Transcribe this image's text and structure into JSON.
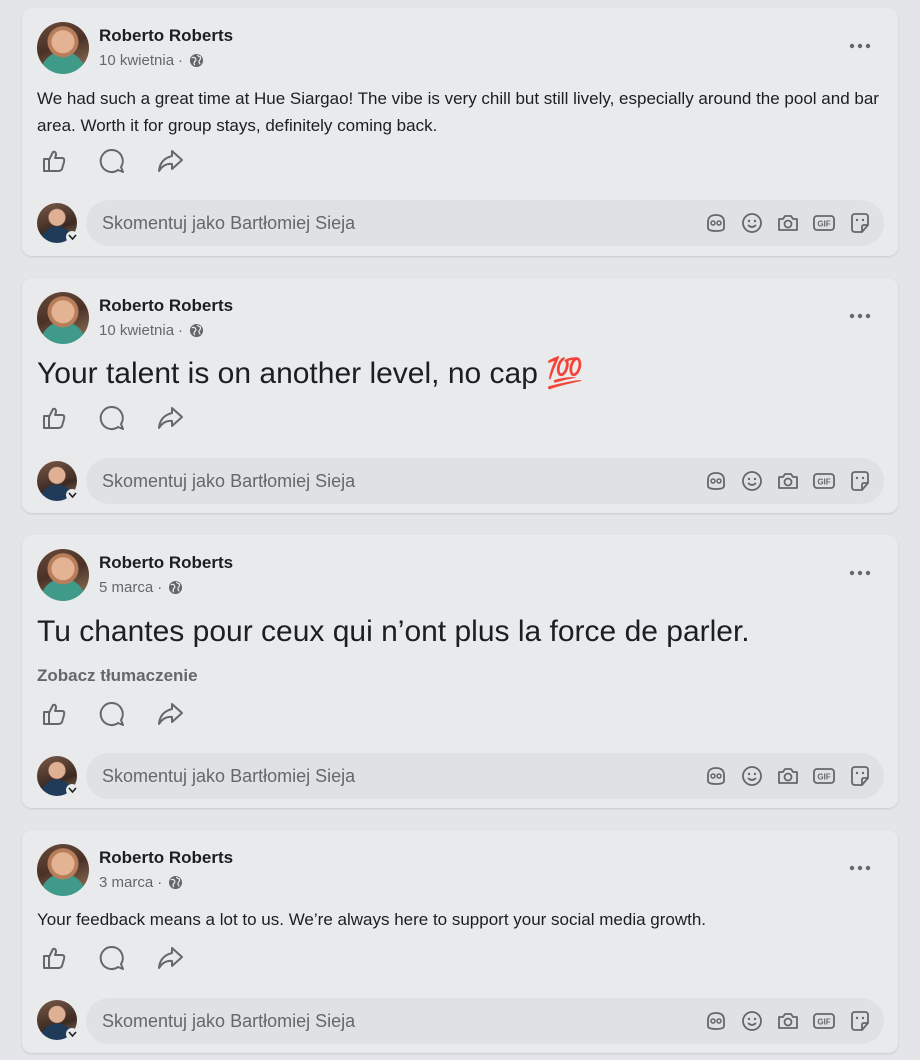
{
  "posts": [
    {
      "author": "Roberto Roberts",
      "date": "10 kwietnia",
      "separator": "·",
      "text": "We had such a great time at Hue Siargao! The vibe is very chill but still lively, especially around the pool and bar area. Worth it for group stays, definitely coming back.",
      "translate": "",
      "comment_placeholder": "Skomentuj jako Bartłomiej Sieja"
    },
    {
      "author": "Roberto Roberts",
      "date": "10 kwietnia",
      "separator": "·",
      "text": "Your talent is on another level, no cap 💯",
      "translate": "",
      "comment_placeholder": "Skomentuj jako Bartłomiej Sieja"
    },
    {
      "author": "Roberto Roberts",
      "date": "5 marca",
      "separator": "·",
      "text": "Tu chantes pour ceux qui n’ont plus la force de parler.",
      "translate": "Zobacz tłumaczenie",
      "comment_placeholder": "Skomentuj jako Bartłomiej Sieja"
    },
    {
      "author": "Roberto Roberts",
      "date": "3 marca",
      "separator": "·",
      "text": "Your feedback means a lot to us. We’re always here to support your social media growth.",
      "translate": "",
      "comment_placeholder": "Skomentuj jako Bartłomiej Sieja"
    }
  ],
  "icons": {
    "visibility": "globe-icon",
    "menu": "more-icon",
    "like": "like-icon",
    "comment": "comment-icon",
    "share": "share-icon",
    "comment_tools": [
      "avatar-sticker-icon",
      "emoji-icon",
      "camera-icon",
      "gif-icon",
      "sticker-icon"
    ]
  },
  "colors": {
    "page_background": "#e4e5e8",
    "card_background": "#e9eaec",
    "secondary_text": "#65676b",
    "primary_text": "#1c1e21"
  }
}
